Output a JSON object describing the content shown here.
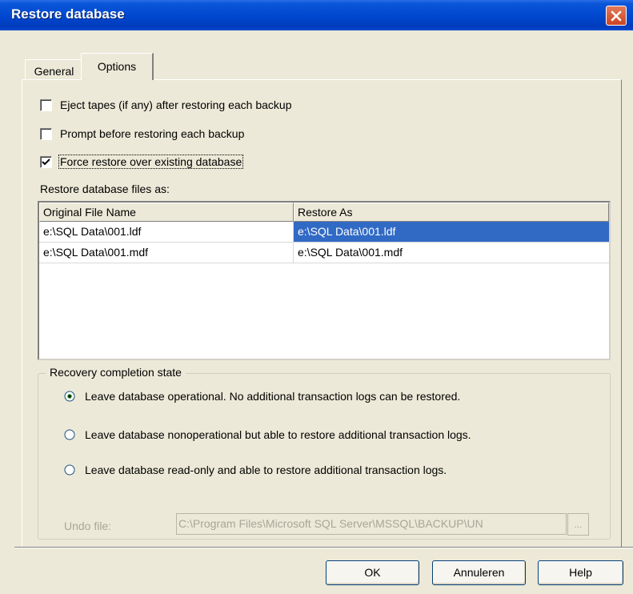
{
  "window": {
    "title": "Restore database"
  },
  "tabs": [
    {
      "label": "General",
      "active": false
    },
    {
      "label": "Options",
      "active": true
    }
  ],
  "options": {
    "checkboxes": [
      {
        "label": "Eject tapes (if any) after restoring each backup",
        "checked": false
      },
      {
        "label": "Prompt before restoring each backup",
        "checked": false
      },
      {
        "label": "Force restore over existing database",
        "checked": true
      }
    ],
    "restore_files_label": "Restore database files as:",
    "files_table": {
      "columns": [
        "Original File Name",
        "Restore As"
      ],
      "rows": [
        {
          "original": "e:\\SQL Data\\001.ldf",
          "restore_as": "e:\\SQL Data\\001.ldf",
          "selected": true
        },
        {
          "original": "e:\\SQL Data\\001.mdf",
          "restore_as": "e:\\SQL Data\\001.mdf",
          "selected": false
        }
      ]
    },
    "recovery": {
      "legend": "Recovery completion state",
      "radios": [
        {
          "label": "Leave database operational. No additional transaction logs can be restored.",
          "selected": true
        },
        {
          "label": "Leave database nonoperational but able to restore additional transaction logs.",
          "selected": false
        },
        {
          "label": "Leave database read-only and able to restore additional transaction logs.",
          "selected": false
        }
      ],
      "undo_label": "Undo file:",
      "undo_value": "C:\\Program Files\\Microsoft SQL Server\\MSSQL\\BACKUP\\UN",
      "browse_label": "..."
    }
  },
  "buttons": {
    "ok": "OK",
    "cancel": "Annuleren",
    "help": "Help"
  },
  "colors": {
    "title_bar": "#0047cf",
    "selection": "#316ac5",
    "face": "#ece9d8"
  },
  "icons": {
    "close": "close-icon",
    "check": "checkmark-icon",
    "radio": "radio-icon"
  }
}
